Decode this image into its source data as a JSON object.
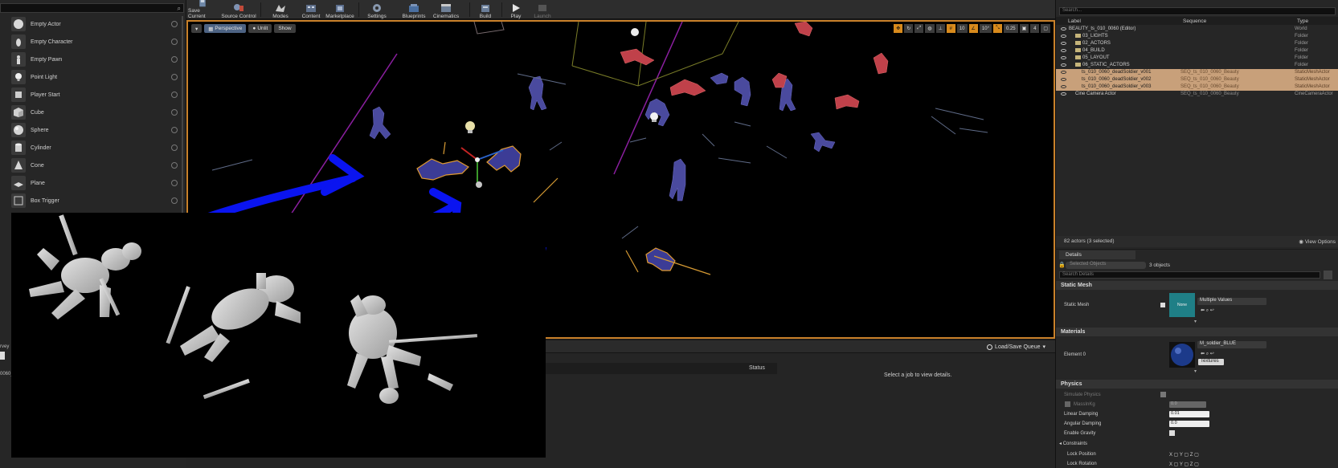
{
  "modes": {
    "items": [
      {
        "label": "Empty Actor",
        "icon": "sphere-icon"
      },
      {
        "label": "Empty Character",
        "icon": "character-icon"
      },
      {
        "label": "Empty Pawn",
        "icon": "pawn-icon"
      },
      {
        "label": "Point Light",
        "icon": "lightbulb-icon"
      },
      {
        "label": "Player Start",
        "icon": "player-start-icon"
      },
      {
        "label": "Cube",
        "icon": "cube-icon"
      },
      {
        "label": "Sphere",
        "icon": "sphere-icon"
      },
      {
        "label": "Cylinder",
        "icon": "cylinder-icon"
      },
      {
        "label": "Cone",
        "icon": "cone-icon"
      },
      {
        "label": "Plane",
        "icon": "plane-icon"
      },
      {
        "label": "Box Trigger",
        "icon": "box-trigger-icon"
      }
    ],
    "left_fragment_1": "rvey",
    "left_fragment_2": "0060_l"
  },
  "toolbar": {
    "save_current": "Save Current",
    "source_control": "Source Control",
    "modes": "Modes",
    "content": "Content",
    "marketplace": "Marketplace",
    "settings": "Settings",
    "blueprints": "Blueprints",
    "cinematics": "Cinematics",
    "build": "Build",
    "play": "Play",
    "launch": "Launch"
  },
  "viewport": {
    "perspective": "Perspective",
    "lit": "Unlit",
    "show": "Show",
    "grid_snap": "10",
    "rot_snap": "10°",
    "scale_snap": "0.25",
    "cam_speed": "4"
  },
  "queue": {
    "load_save": "Load/Save Queue",
    "status_col": "Status",
    "detail_msg": "Select a job to view details."
  },
  "outliner": {
    "search_placeholder": "Search...",
    "col_label": "Label",
    "col_sequence": "Sequence",
    "col_type": "Type",
    "rows": [
      {
        "name": "BEAUTY_ts_010_0060 (Editor)",
        "seq": "",
        "type": "World"
      },
      {
        "name": "03_LIGHTS",
        "seq": "",
        "type": "Folder"
      },
      {
        "name": "02_ACTORS",
        "seq": "",
        "type": "Folder"
      },
      {
        "name": "04_BUILD",
        "seq": "",
        "type": "Folder"
      },
      {
        "name": "05_LAYOUT",
        "seq": "",
        "type": "Folder"
      },
      {
        "name": "06_STATIC_ACTORS",
        "seq": "",
        "type": "Folder"
      },
      {
        "name": "ts_010_0060_deadSoldier_v001",
        "seq": "SEQ_ts_010_0060_Beauty",
        "type": "StaticMeshActor"
      },
      {
        "name": "ts_010_0060_deadSoldier_v002",
        "seq": "SEQ_ts_010_0060_Beauty",
        "type": "StaticMeshActor"
      },
      {
        "name": "ts_010_0060_deadSoldier_v003",
        "seq": "SEQ_ts_010_0060_Beauty",
        "type": "StaticMeshActor"
      },
      {
        "name": "Cine Camera Actor",
        "seq": "SEQ_ts_010_0060_Beauty",
        "type": "CineCameraActor"
      }
    ],
    "actor_count": "82 actors (3 selected)",
    "view_options": "View Options"
  },
  "details": {
    "tab": "Details",
    "selected_placeholder": "Selected Objects",
    "selected_count": "3 objects",
    "search_placeholder": "Search Details",
    "static_mesh_cat": "Static Mesh",
    "static_mesh_label": "Static Mesh",
    "static_mesh_thumb": "None",
    "static_mesh_value": "Multiple Values",
    "materials_cat": "Materials",
    "element_label": "Element 0",
    "material_value": "M_soldier_BLUE",
    "textures_btn": "Textures",
    "physics_cat": "Physics",
    "simulate_physics": "Simulate Physics",
    "mass_kg": "MassInKg",
    "mass_value": "0.0",
    "linear_damping": "Linear Damping",
    "linear_damping_value": "0.01",
    "angular_damping": "Angular Damping",
    "angular_damping_value": "0.0",
    "enable_gravity": "Enable Gravity",
    "constraints": "Constraints",
    "lock_position": "Lock Position",
    "lock_rotation": "Lock Rotation"
  }
}
